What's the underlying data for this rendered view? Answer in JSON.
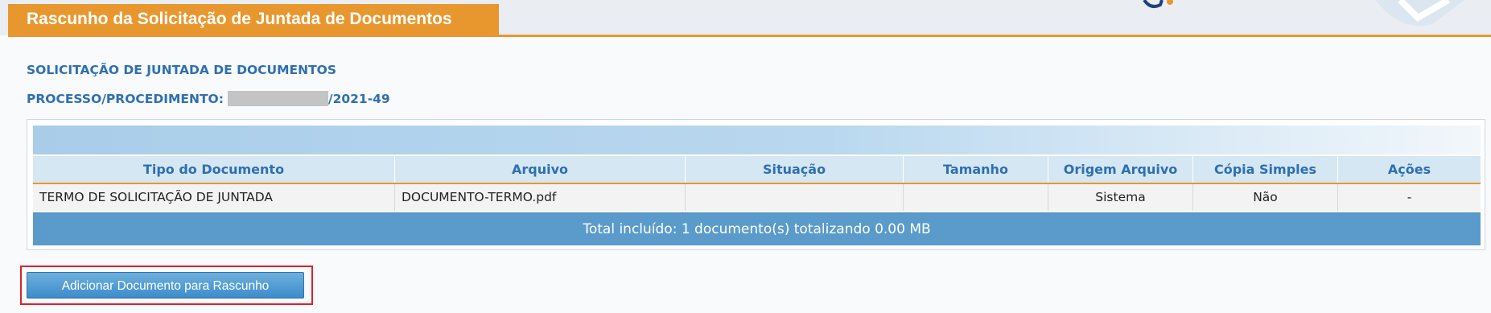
{
  "header": {
    "title": "Rascunho da Solicitação de Juntada de Documentos"
  },
  "section": {
    "title": "SOLICITAÇÃO DE JUNTADA DE DOCUMENTOS",
    "process_label": "PROCESSO/PROCEDIMENTO:",
    "process_suffix": "/2021-49"
  },
  "table": {
    "columns": [
      "Tipo do Documento",
      "Arquivo",
      "Situação",
      "Tamanho",
      "Origem Arquivo",
      "Cópia Simples",
      "Ações"
    ],
    "rows": [
      {
        "tipo": "TERMO DE SOLICITAÇÃO DE JUNTADA",
        "arquivo": "DOCUMENTO-TERMO.pdf",
        "situacao": "",
        "tamanho": "",
        "origem": "Sistema",
        "copia": "Não",
        "acoes": "-"
      }
    ],
    "footer": "Total incluído: 1 documento(s) totalizando 0.00 MB"
  },
  "actions": {
    "add_button_label": "Adicionar Documento para Rascunho"
  },
  "colors": {
    "accent": "#e8972f",
    "label_blue": "#2e6fb2",
    "footer_blue": "#5a9bcb",
    "highlight": "#e0202a"
  }
}
